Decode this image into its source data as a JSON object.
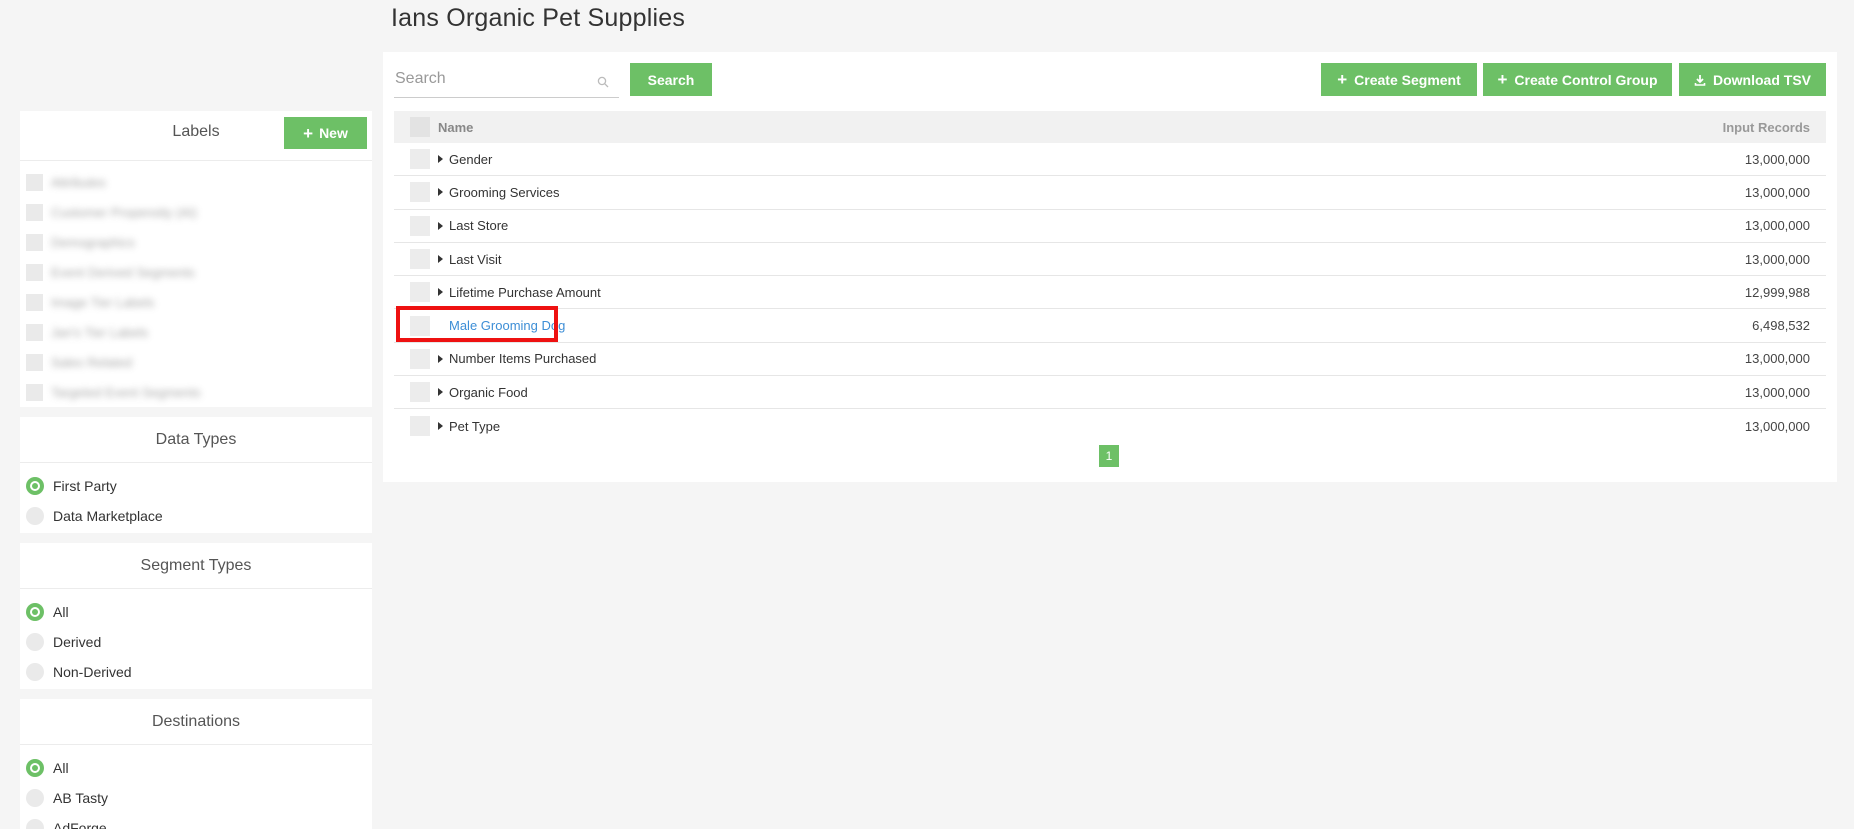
{
  "page": {
    "title": "Ians Organic Pet Supplies"
  },
  "labels": {
    "title": "Labels",
    "new_button": "New",
    "items": [
      "Attributes",
      "Customer Propensity (AI)",
      "Demographics",
      "Event Derived Segments",
      "Image Tier Labels",
      "Jan's Tier Labels",
      "Sales Related",
      "Targeted Event Segments"
    ]
  },
  "data_types": {
    "title": "Data Types",
    "options": [
      "First Party",
      "Data Marketplace"
    ],
    "selected": "First Party"
  },
  "segment_types": {
    "title": "Segment Types",
    "options": [
      "All",
      "Derived",
      "Non-Derived"
    ],
    "selected": "All"
  },
  "destinations": {
    "title": "Destinations",
    "options": [
      "All",
      "AB Tasty",
      "AdForge"
    ],
    "selected": "All"
  },
  "toolbar": {
    "search_placeholder": "Search",
    "search_button": "Search",
    "create_segment": "Create Segment",
    "create_control_group": "Create Control Group",
    "download_tsv": "Download TSV"
  },
  "table": {
    "columns": {
      "name": "Name",
      "records": "Input Records"
    },
    "rows": [
      {
        "name": "Gender",
        "records": "13,000,000",
        "expandable": true
      },
      {
        "name": "Grooming Services",
        "records": "13,000,000",
        "expandable": true
      },
      {
        "name": "Last Store",
        "records": "13,000,000",
        "expandable": true
      },
      {
        "name": "Last Visit",
        "records": "13,000,000",
        "expandable": true
      },
      {
        "name": "Lifetime Purchase Amount",
        "records": "12,999,988",
        "expandable": true
      },
      {
        "name": "Male Grooming Dog",
        "records": "6,498,532",
        "expandable": false
      },
      {
        "name": "Number Items Purchased",
        "records": "13,000,000",
        "expandable": true
      },
      {
        "name": "Organic Food",
        "records": "13,000,000",
        "expandable": true
      },
      {
        "name": "Pet Type",
        "records": "13,000,000",
        "expandable": true
      }
    ]
  },
  "pagination": {
    "current_page": "1"
  },
  "colors": {
    "accent_green": "#6dc066",
    "link_blue": "#3d8ed6",
    "highlight_red": "#ee1111"
  }
}
